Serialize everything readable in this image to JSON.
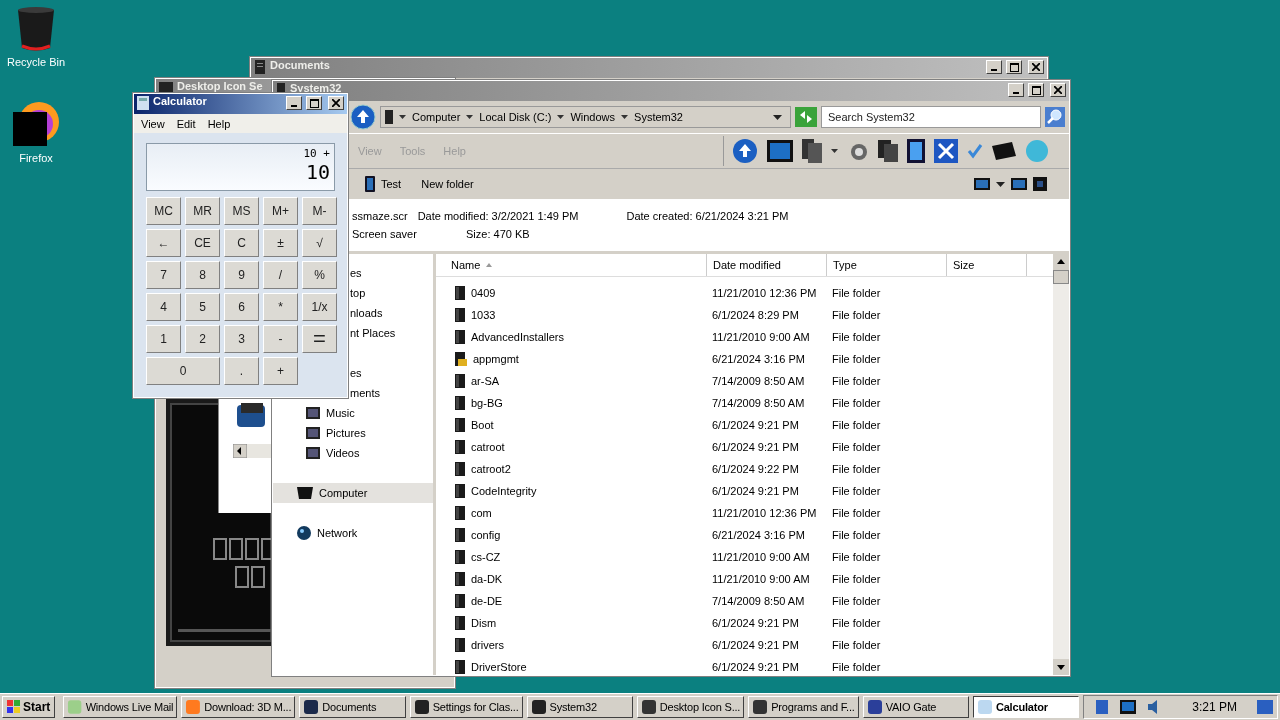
{
  "desktop_icons": [
    {
      "label": "Recycle Bin"
    },
    {
      "label": "Firefox"
    }
  ],
  "documents_window": {
    "title": "Documents"
  },
  "desktop_icon_window": {
    "title": "Desktop Icon Se"
  },
  "explorer": {
    "title": "System32",
    "breadcrumb": [
      "Computer",
      "Local Disk (C:)",
      "Windows",
      "System32"
    ],
    "search": {
      "placeholder": "Search System32"
    },
    "menu": [
      {
        "label": "View",
        "disabled": true
      },
      {
        "label": "Tools",
        "disabled": true
      },
      {
        "label": "Help",
        "disabled": true
      }
    ],
    "commands": [
      {
        "label": "Test",
        "kind": "icon"
      },
      {
        "label": "New folder",
        "kind": "text"
      }
    ],
    "details": {
      "name": "ssmaze.scr",
      "modified": "Date modified: 3/2/2021 1:49 PM",
      "created": "Date created: 6/21/2024 3:21 PM",
      "type": "Screen saver",
      "size": "Size: 470 KB"
    },
    "nav_groups": [
      {
        "items": [
          {
            "label": "es",
            "kind": "clipped",
            "selected": false
          },
          {
            "label": "top",
            "kind": "clipped",
            "selected": false
          },
          {
            "label": "nloads",
            "kind": "clipped",
            "selected": false
          },
          {
            "label": "nt Places",
            "kind": "clipped",
            "selected": false
          }
        ]
      },
      {
        "items": [
          {
            "label": "es",
            "kind": "clipped",
            "selected": false
          },
          {
            "label": "ments",
            "kind": "clipped",
            "selected": false
          },
          {
            "label": "Music",
            "kind": "child",
            "selected": false
          },
          {
            "label": "Pictures",
            "kind": "child",
            "selected": false
          },
          {
            "label": "Videos",
            "kind": "child",
            "selected": false
          }
        ]
      },
      {
        "items": [
          {
            "label": "Computer",
            "kind": "top",
            "selected": true
          }
        ]
      },
      {
        "items": [
          {
            "label": "Network",
            "kind": "top",
            "selected": false
          }
        ]
      }
    ],
    "columns": [
      "Name",
      "Date modified",
      "Type",
      "Size"
    ],
    "rows": [
      {
        "name": "0409",
        "modified": "11/21/2010 12:36 PM",
        "type": "File folder",
        "kind": "folder"
      },
      {
        "name": "1033",
        "modified": "6/1/2024 8:29 PM",
        "type": "File folder",
        "kind": "folder"
      },
      {
        "name": "AdvancedInstallers",
        "modified": "11/21/2010 9:00 AM",
        "type": "File folder",
        "kind": "folder"
      },
      {
        "name": "appmgmt",
        "modified": "6/21/2024 3:16 PM",
        "type": "File folder",
        "kind": "locked"
      },
      {
        "name": "ar-SA",
        "modified": "7/14/2009 8:50 AM",
        "type": "File folder",
        "kind": "folder"
      },
      {
        "name": "bg-BG",
        "modified": "7/14/2009 8:50 AM",
        "type": "File folder",
        "kind": "folder"
      },
      {
        "name": "Boot",
        "modified": "6/1/2024 9:21 PM",
        "type": "File folder",
        "kind": "folder"
      },
      {
        "name": "catroot",
        "modified": "6/1/2024 9:21 PM",
        "type": "File folder",
        "kind": "folder"
      },
      {
        "name": "catroot2",
        "modified": "6/1/2024 9:22 PM",
        "type": "File folder",
        "kind": "folder"
      },
      {
        "name": "CodeIntegrity",
        "modified": "6/1/2024 9:21 PM",
        "type": "File folder",
        "kind": "folder"
      },
      {
        "name": "com",
        "modified": "11/21/2010 12:36 PM",
        "type": "File folder",
        "kind": "folder"
      },
      {
        "name": "config",
        "modified": "6/21/2024 3:16 PM",
        "type": "File folder",
        "kind": "folder"
      },
      {
        "name": "cs-CZ",
        "modified": "11/21/2010 9:00 AM",
        "type": "File folder",
        "kind": "folder"
      },
      {
        "name": "da-DK",
        "modified": "11/21/2010 9:00 AM",
        "type": "File folder",
        "kind": "folder"
      },
      {
        "name": "de-DE",
        "modified": "7/14/2009 8:50 AM",
        "type": "File folder",
        "kind": "folder"
      },
      {
        "name": "Dism",
        "modified": "6/1/2024 9:21 PM",
        "type": "File folder",
        "kind": "folder"
      },
      {
        "name": "drivers",
        "modified": "6/1/2024 9:21 PM",
        "type": "File folder",
        "kind": "folder"
      },
      {
        "name": "DriverStore",
        "modified": "6/1/2024 9:21 PM",
        "type": "File folder",
        "kind": "folder"
      }
    ]
  },
  "calculator": {
    "title": "Calculator",
    "menu": [
      "View",
      "Edit",
      "Help"
    ],
    "expression": "10 +",
    "value": "10",
    "keys": [
      {
        "label": "MC",
        "kind": "key"
      },
      {
        "label": "MR",
        "kind": "key"
      },
      {
        "label": "MS",
        "kind": "key"
      },
      {
        "label": "M+",
        "kind": "key"
      },
      {
        "label": "M-",
        "kind": "key"
      },
      {
        "label": "←",
        "kind": "key"
      },
      {
        "label": "CE",
        "kind": "key"
      },
      {
        "label": "C",
        "kind": "key"
      },
      {
        "label": "±",
        "kind": "key"
      },
      {
        "label": "√",
        "kind": "key"
      },
      {
        "label": "7",
        "kind": "key"
      },
      {
        "label": "8",
        "kind": "key"
      },
      {
        "label": "9",
        "kind": "key"
      },
      {
        "label": "/",
        "kind": "key"
      },
      {
        "label": "%",
        "kind": "key"
      },
      {
        "label": "4",
        "kind": "key"
      },
      {
        "label": "5",
        "kind": "key"
      },
      {
        "label": "6",
        "kind": "key"
      },
      {
        "label": "*",
        "kind": "key"
      },
      {
        "label": "1/x",
        "kind": "key"
      },
      {
        "label": "1",
        "kind": "key"
      },
      {
        "label": "2",
        "kind": "key"
      },
      {
        "label": "3",
        "kind": "key"
      },
      {
        "label": "-",
        "kind": "key"
      },
      {
        "label": "=",
        "kind": "tall"
      },
      {
        "label": "0",
        "kind": "wide"
      },
      {
        "label": ".",
        "kind": "key"
      },
      {
        "label": "+",
        "kind": "key"
      }
    ]
  },
  "taskbar": {
    "start": "Start",
    "items": [
      {
        "label": "Windows Live Mail",
        "selected": false
      },
      {
        "label": "Download: 3D M...",
        "selected": false
      },
      {
        "label": "Documents",
        "selected": false
      },
      {
        "label": "Settings for Clas...",
        "selected": false
      },
      {
        "label": "System32",
        "selected": false
      },
      {
        "label": "Desktop Icon S...",
        "selected": false
      },
      {
        "label": "Programs and F...",
        "selected": false
      },
      {
        "label": "VAIO Gate",
        "selected": false
      },
      {
        "label": "Calculator",
        "selected": true
      }
    ],
    "clock": "3:21 PM"
  }
}
